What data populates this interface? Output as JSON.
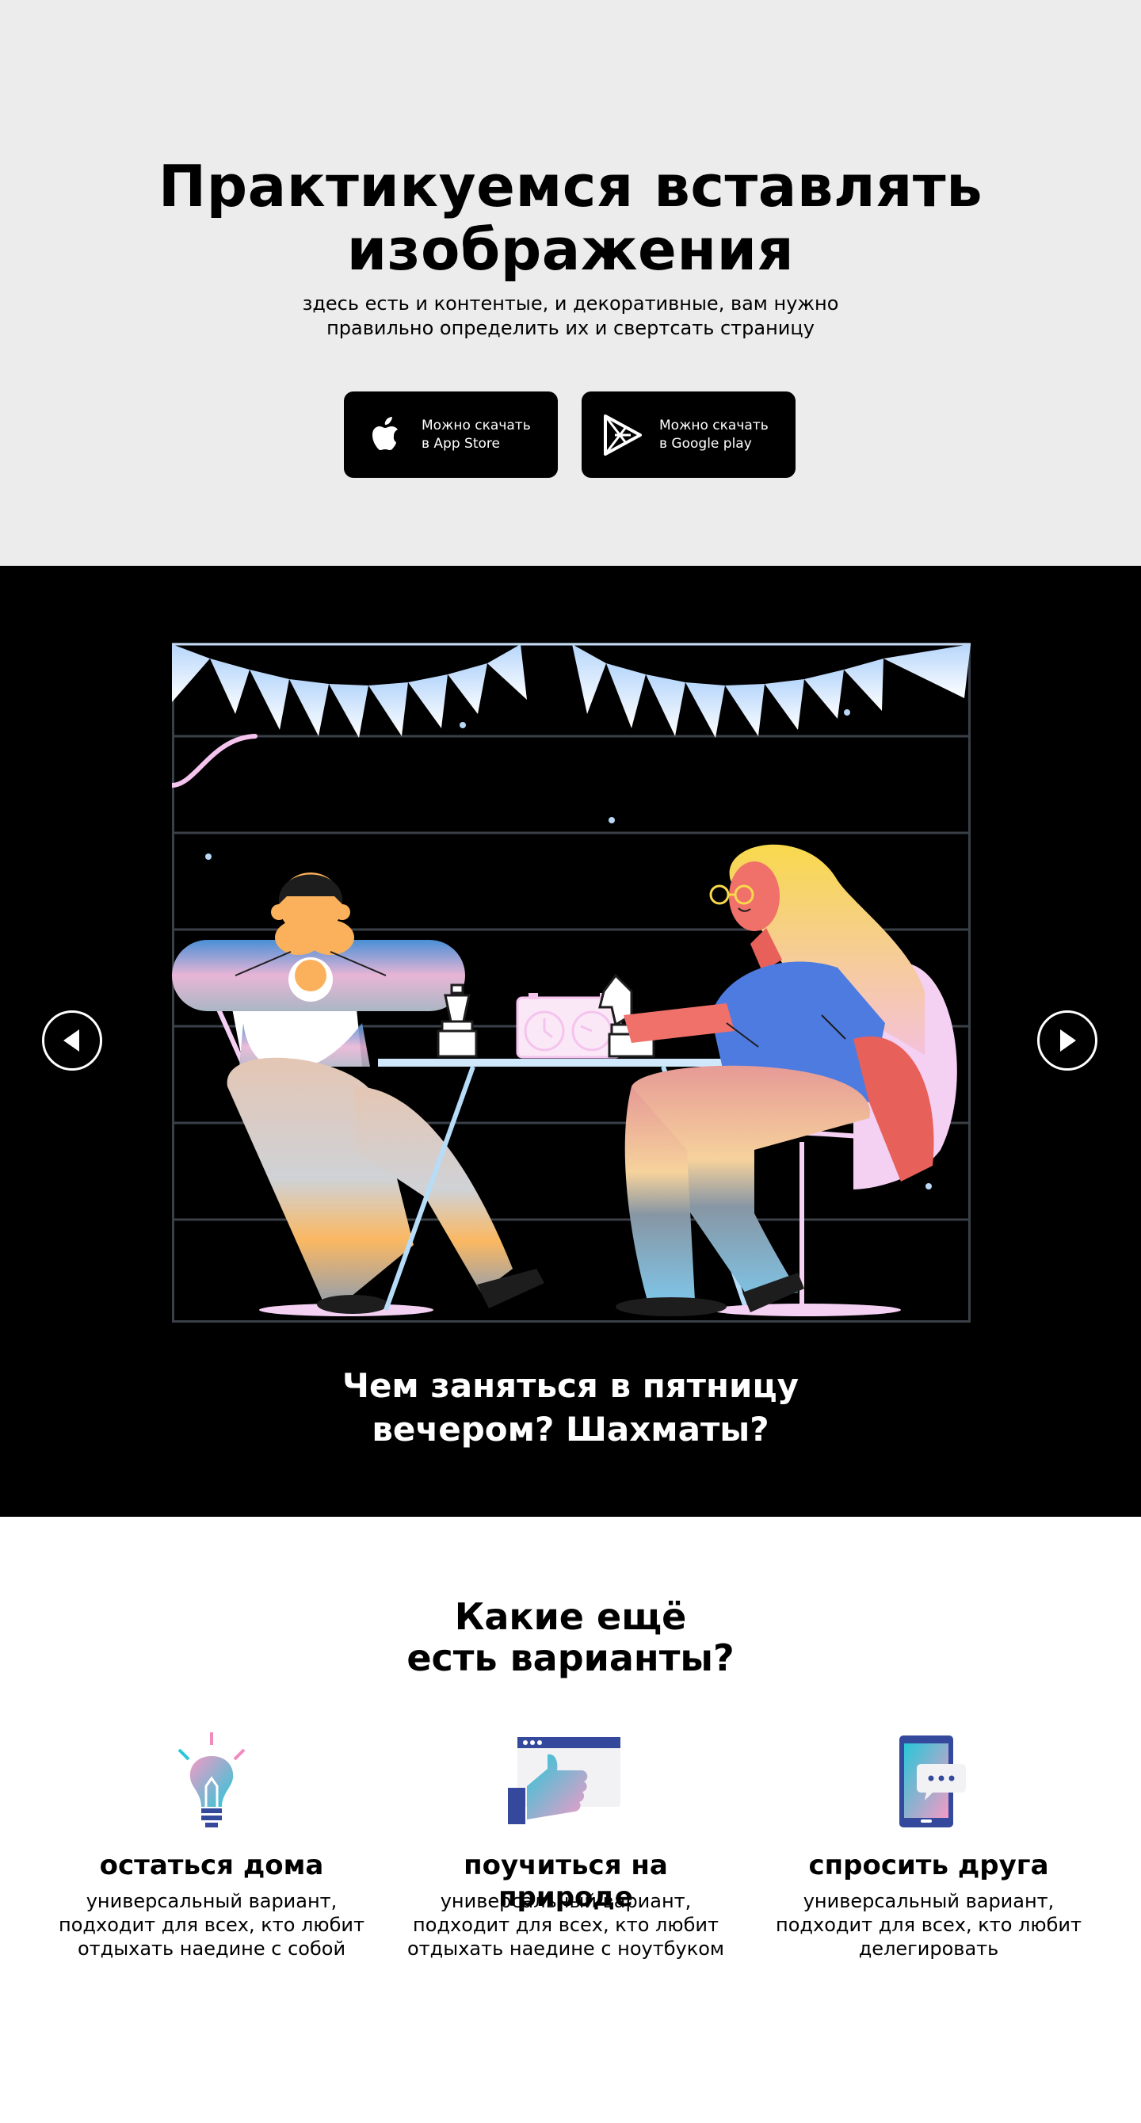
{
  "hero": {
    "title_line1": "Практикуемся вставлять",
    "title_line2": "изображения",
    "subtitle_line1": "здесь есть и контентые, и декоративные, вам нужно",
    "subtitle_line2": "правильно определить их и свертсать страницу",
    "buttons": [
      {
        "icon": "apple-icon",
        "line1": "Можно скачать",
        "line2": "в App Store"
      },
      {
        "icon": "google-play-icon",
        "line1": "Можно скачать",
        "line2": "в Google play"
      }
    ]
  },
  "slider": {
    "caption_line1": "Чем заняться в пятницу",
    "caption_line2": "вечером? Шахматы?",
    "prev_icon": "arrow-left-icon",
    "next_icon": "arrow-right-icon"
  },
  "options": {
    "title_line1": "Какие ещё",
    "title_line2": "есть варианты?",
    "items": [
      {
        "icon": "lightbulb-icon",
        "title": "остаться дома",
        "desc_line1": "универсальный вариант,",
        "desc_line2": "подходит для всех, кто любит",
        "desc_line3": "отдыхать наедине с собой"
      },
      {
        "icon": "thumbs-up-icon",
        "title": "поучиться на природе",
        "desc_line1": "универсальный вариант,",
        "desc_line2": "подходит для всех, кто любит",
        "desc_line3": "отдыхать наедине с ноутбуком"
      },
      {
        "icon": "phone-chat-icon",
        "title": "спросить друга",
        "desc_line1": "универсальный вариант,",
        "desc_line2": "подходит для всех, кто любит",
        "desc_line3": "делегировать"
      }
    ]
  },
  "colors": {
    "hero_bg": "#ececec",
    "slider_bg": "#000000",
    "accent_pink": "#f3d3f5",
    "accent_blue": "#4e7be0",
    "skin": "#fbb15c",
    "grid": "#3a4048"
  }
}
